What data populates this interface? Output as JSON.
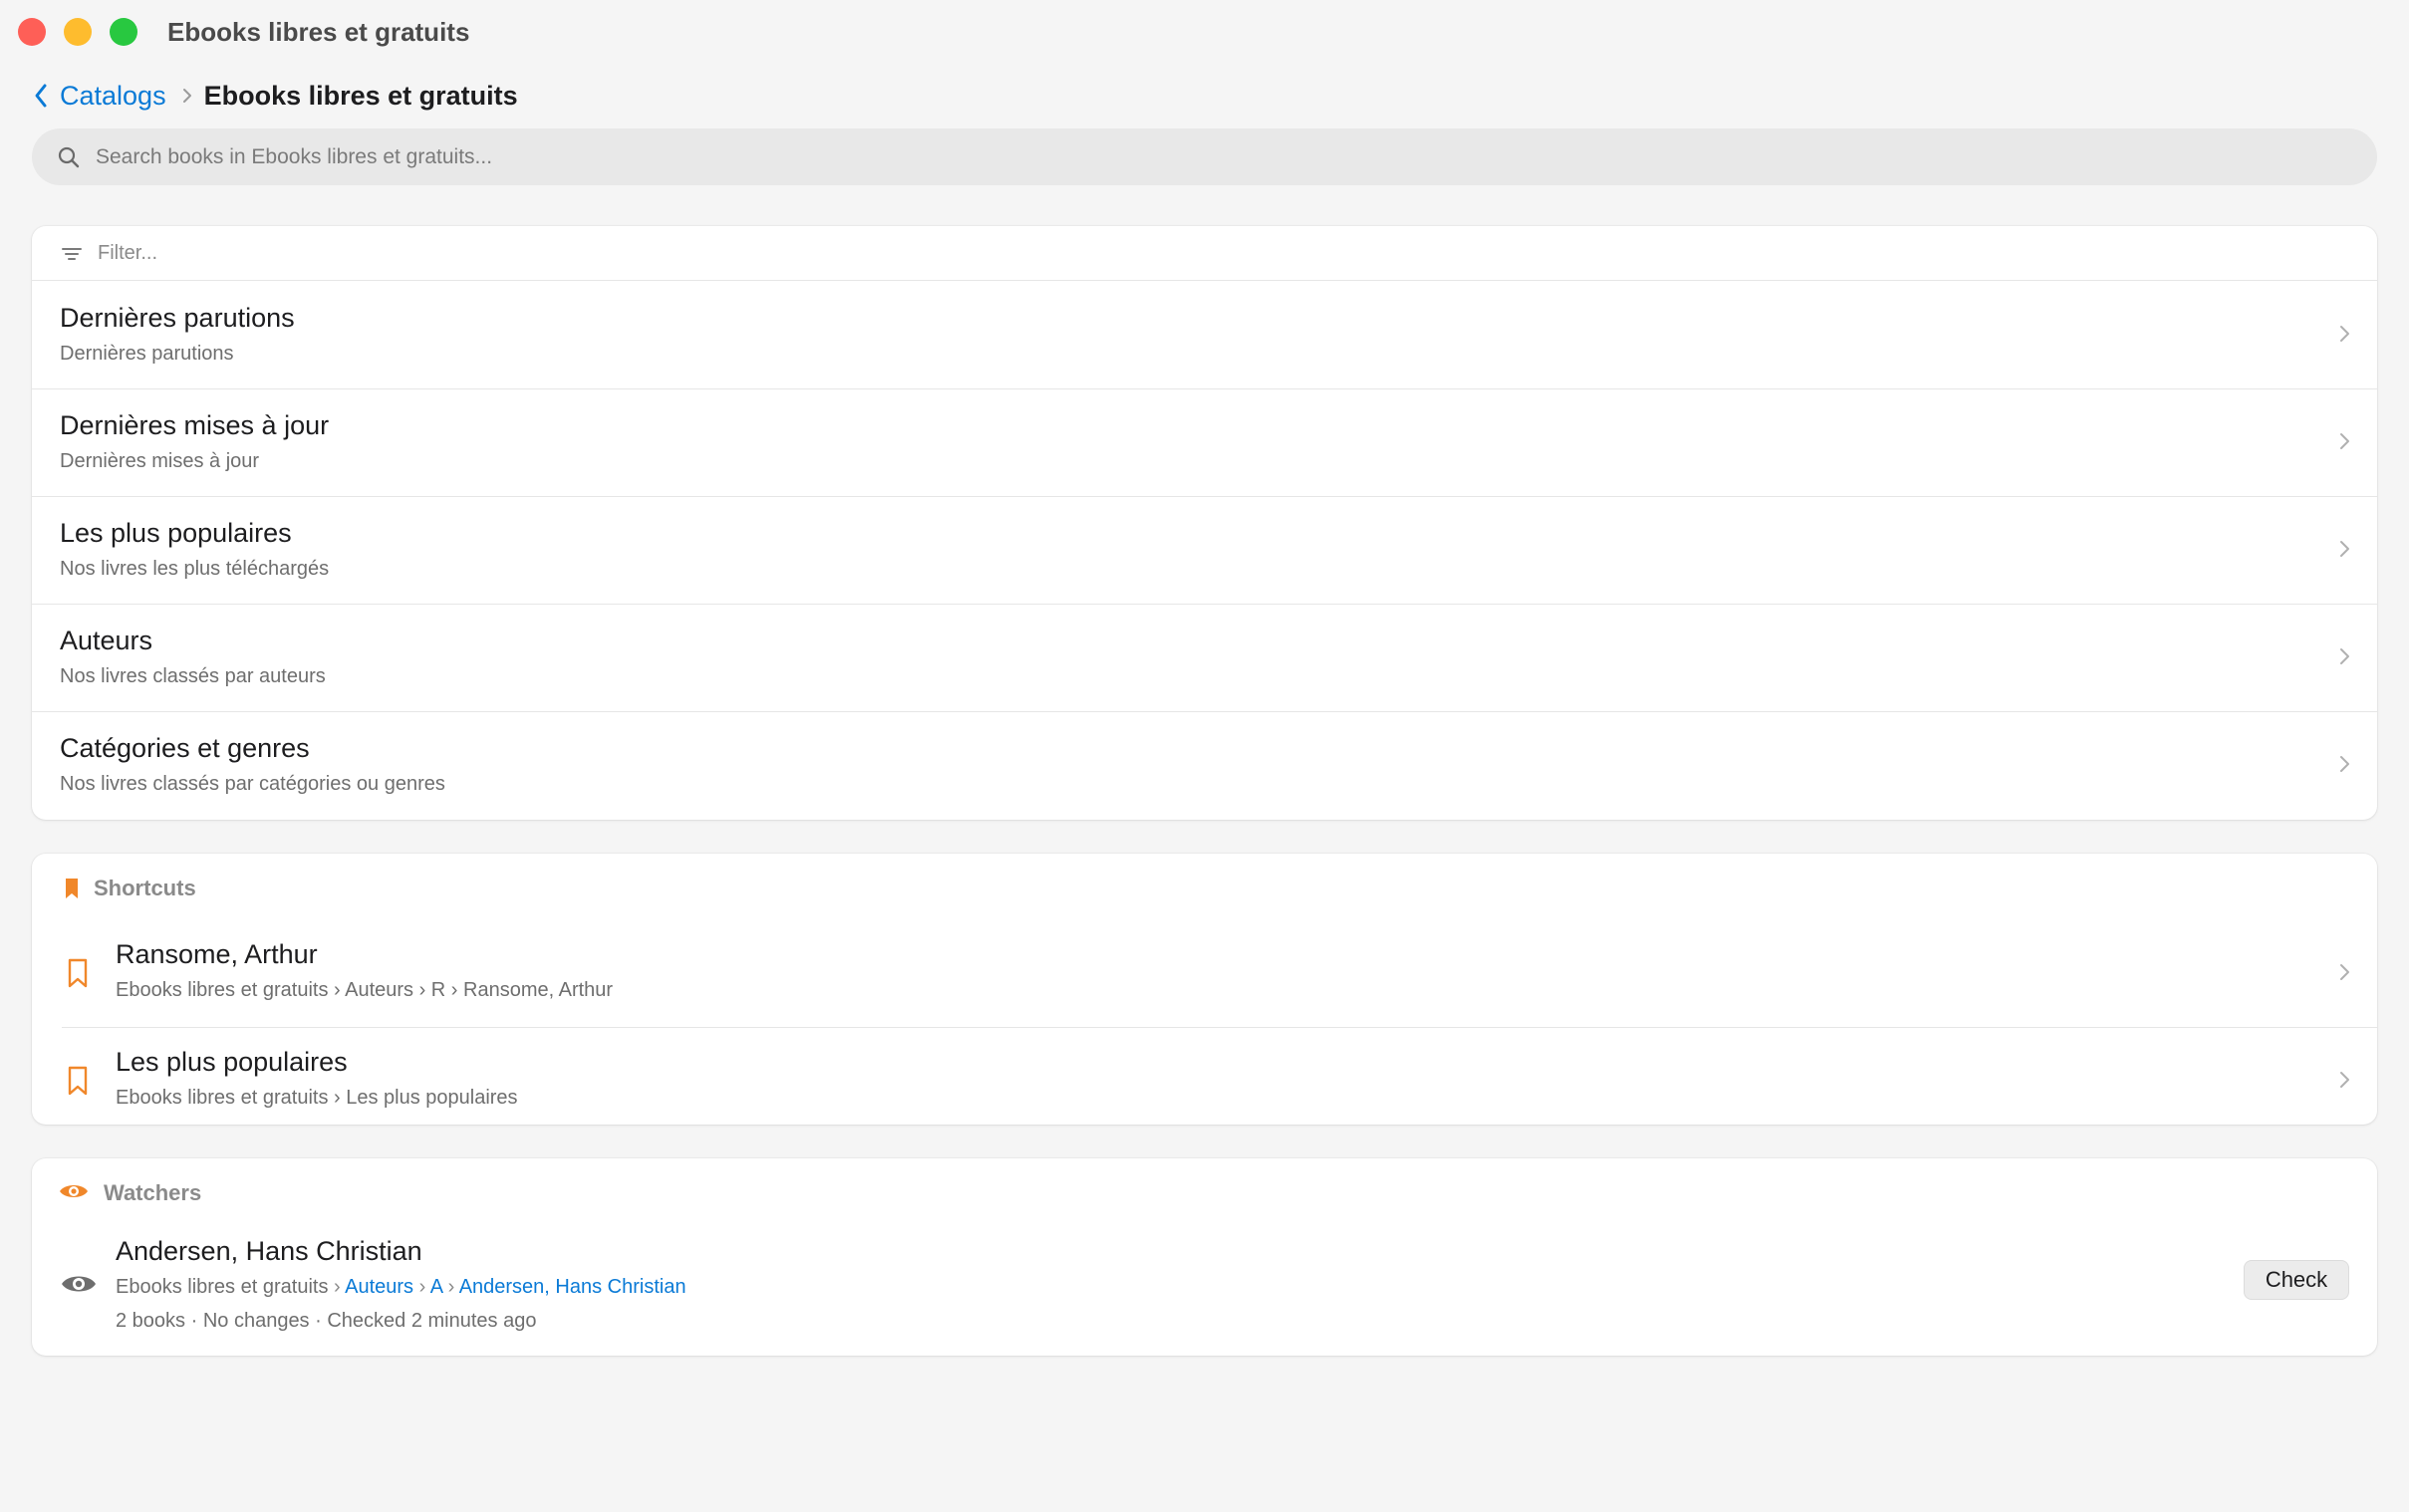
{
  "window": {
    "title": "Ebooks libres et gratuits"
  },
  "breadcrumb": {
    "back_label": "Catalogs",
    "current": "Ebooks libres et gratuits"
  },
  "search": {
    "placeholder": "Search books in Ebooks libres et gratuits..."
  },
  "filter": {
    "placeholder": "Filter..."
  },
  "catalog_items": [
    {
      "title": "Dernières parutions",
      "subtitle": "Dernières parutions"
    },
    {
      "title": "Dernières mises à jour",
      "subtitle": "Dernières mises à jour"
    },
    {
      "title": "Les plus populaires",
      "subtitle": "Nos livres les plus téléchargés"
    },
    {
      "title": "Auteurs",
      "subtitle": "Nos livres classés par auteurs"
    },
    {
      "title": "Catégories et genres",
      "subtitle": "Nos livres classés par catégories ou genres"
    }
  ],
  "shortcuts": {
    "header": "Shortcuts",
    "items": [
      {
        "title": "Ransome, Arthur",
        "path": "Ebooks libres et gratuits › Auteurs › R › Ransome, Arthur"
      },
      {
        "title": "Les plus populaires",
        "path": "Ebooks libres et gratuits › Les plus populaires"
      }
    ]
  },
  "watchers": {
    "header": "Watchers",
    "items": [
      {
        "title": "Andersen, Hans Christian",
        "path_root": "Ebooks libres et gratuits",
        "path_sep": "›",
        "path_links": [
          "Auteurs",
          "A",
          "Andersen, Hans Christian"
        ],
        "meta": "2 books · No changes · Checked 2 minutes ago",
        "button_label": "Check"
      }
    ]
  },
  "colors": {
    "accent": "#0a7ad6",
    "bookmark": "#f0872a",
    "background": "#f5f5f5",
    "card": "#ffffff"
  },
  "icons": {
    "back": "chevron-left-icon",
    "separator": "chevron-right-icon",
    "search": "search-icon",
    "filter": "filter-lines-icon",
    "row": "chevron-right-icon",
    "shortcuts": "bookmark-filled-icon",
    "shortcut_item": "bookmark-outline-icon",
    "watchers": "eye-icon"
  }
}
